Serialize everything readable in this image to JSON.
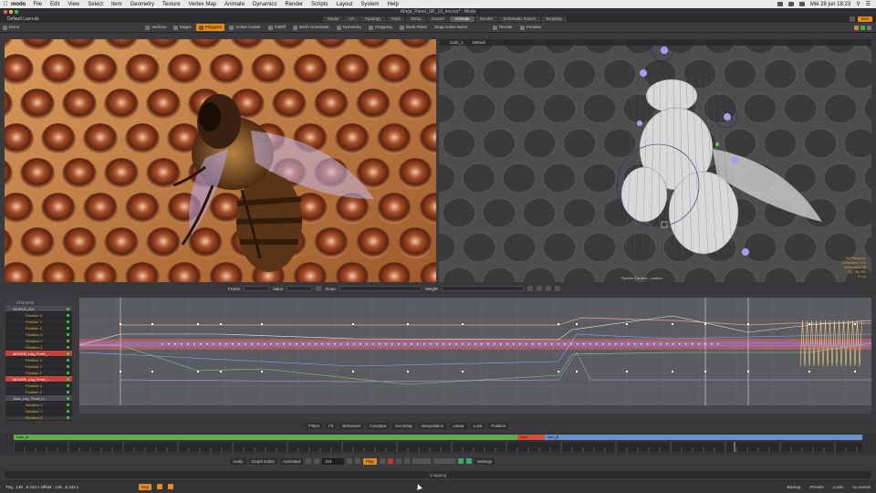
{
  "menubar": {
    "app": "modo",
    "items": [
      "File",
      "Edit",
      "View",
      "Select",
      "Item",
      "Geometry",
      "Texture",
      "Vertex Map",
      "Animate",
      "Dynamics",
      "Render",
      "Scripts",
      "Layout",
      "System",
      "Help"
    ],
    "clock": "Mié 28 jun 18:23"
  },
  "window": {
    "title": "Abeja_Panel_SR_10_mo.lxo* - Modo"
  },
  "layout": {
    "selector": "Default Layouts",
    "tabs": [
      "Model",
      "UV",
      "Topology",
      "Paint",
      "Setup",
      "Games",
      "Animate",
      "Render",
      "Schematic Fusion",
      "Scripting"
    ],
    "active_tab": "Animate",
    "right_chip": "Goz"
  },
  "toolbar": {
    "items": [
      "Polygons",
      "Action Center",
      "Falloff",
      "Mesh Constraint",
      "Symmetry",
      "Snapping",
      "Work Plane",
      "Snap Active Items",
      "Render",
      "Preview"
    ],
    "active": "Polygons",
    "left_mode": "Items",
    "items_label": "Vertices",
    "edges_label": "Edges"
  },
  "viewport_right": {
    "camera": "Cam_1",
    "shading": "Default",
    "footer_label": "Render Camera : Locked",
    "stats": [
      "All Polygons",
      "Channels: 172",
      "Deformed: 88",
      "GL: 98,281",
      "5 cm"
    ]
  },
  "properties_bar": {
    "fields": [
      "Frame",
      "Value",
      "Slope",
      "Weight"
    ]
  },
  "channels": {
    "header": "Channels",
    "rows": [
      {
        "label": "WORLD_002",
        "type": "grp"
      },
      {
        "label": "Position X",
        "type": "sub"
      },
      {
        "label": "Position Y",
        "type": "sub"
      },
      {
        "label": "Position Z",
        "type": "sub"
      },
      {
        "label": "Rotation X",
        "type": "sub"
      },
      {
        "label": "Rotation Y",
        "type": "sub"
      },
      {
        "label": "Rotation Z",
        "type": "sub"
      },
      {
        "label": "MOVER_Leg_Front_...",
        "type": "red"
      },
      {
        "label": "Position X",
        "type": "sub"
      },
      {
        "label": "Position Y",
        "type": "sub"
      },
      {
        "label": "Position Z",
        "type": "sub"
      },
      {
        "label": "MOVER_Leg_Front_...",
        "type": "red"
      },
      {
        "label": "Position X",
        "type": "sub"
      },
      {
        "label": "Position Z",
        "type": "sub"
      },
      {
        "label": "Joint_Leg_Front_Lt...",
        "type": "grp"
      },
      {
        "label": "Rotation X",
        "type": "sub"
      },
      {
        "label": "Rotation Y",
        "type": "sub"
      },
      {
        "label": "Rotation Z",
        "type": "sub"
      }
    ]
  },
  "graph_controls": {
    "items": [
      "Filters",
      "Fit",
      "Behaviors",
      "Constant",
      "Incoming",
      "Interpolation",
      "Linear",
      "Lock",
      "Position"
    ]
  },
  "timeline": {
    "clip_a": "Cam_A",
    "clip_mid": "Cam",
    "clip_b": "cam_B"
  },
  "transport": {
    "items": [
      "Audio",
      "Graph Editor",
      "Animated",
      "Play",
      "Settings"
    ],
    "frame": "153",
    "active": "Play"
  },
  "command_bar": {
    "text": "snapping"
  },
  "status": {
    "left": "Traj  :  148 , 9.242 s    Offset  :  148 , 6.242 s",
    "key_label": "Key",
    "right": [
      "Backup",
      "Presets",
      "Locks",
      "no events"
    ]
  }
}
